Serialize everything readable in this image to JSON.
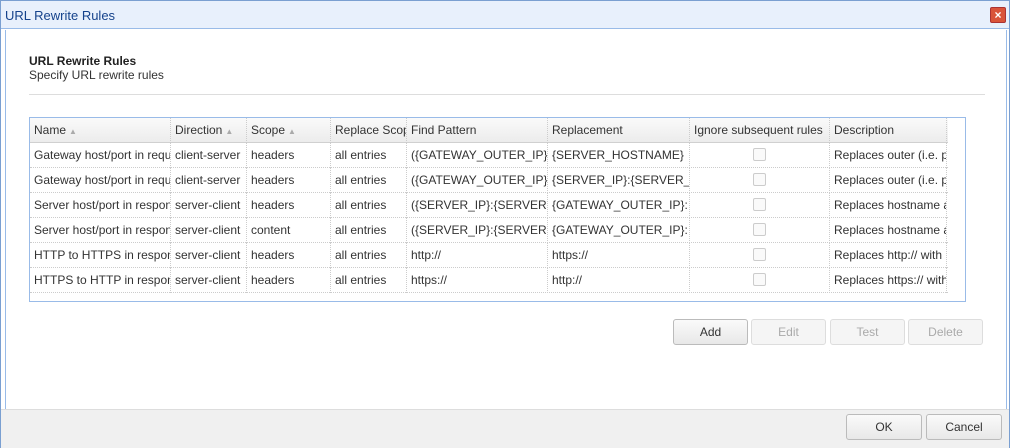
{
  "window": {
    "title": "URL Rewrite Rules",
    "close_icon": "close-icon"
  },
  "header": {
    "title": "URL Rewrite Rules",
    "subtitle": "Specify URL rewrite rules"
  },
  "grid": {
    "columns": [
      {
        "label": "Name",
        "sortable": true
      },
      {
        "label": "Direction",
        "sortable": true
      },
      {
        "label": "Scope",
        "sortable": true
      },
      {
        "label": "Replace Scope",
        "sortable": false
      },
      {
        "label": "Find Pattern",
        "sortable": false
      },
      {
        "label": "Replacement",
        "sortable": false
      },
      {
        "label": "Ignore subsequent rules",
        "sortable": false
      },
      {
        "label": "Description",
        "sortable": false
      }
    ],
    "rows": [
      [
        "Gateway host/port in request",
        "client-server",
        "headers",
        "all entries",
        "({GATEWAY_OUTER_IP}",
        "{SERVER_HOSTNAME}",
        false,
        "Replaces outer (i.e. p"
      ],
      [
        "Gateway host/port in request",
        "client-server",
        "headers",
        "all entries",
        "({GATEWAY_OUTER_IP}",
        "{SERVER_IP}:{SERVER_",
        false,
        "Replaces outer (i.e. p"
      ],
      [
        "Server host/port in response",
        "server-client",
        "headers",
        "all entries",
        "({SERVER_IP}:{SERVER",
        "{GATEWAY_OUTER_IP}:",
        false,
        "Replaces hostname a"
      ],
      [
        "Server host/port in response",
        "server-client",
        "content",
        "all entries",
        "({SERVER_IP}:{SERVER",
        "{GATEWAY_OUTER_IP}:",
        false,
        "Replaces hostname a"
      ],
      [
        "HTTP to HTTPS in response",
        "server-client",
        "headers",
        "all entries",
        "http://",
        "https://",
        false,
        "Replaces http:// with"
      ],
      [
        "HTTPS to HTTP in response",
        "server-client",
        "headers",
        "all entries",
        "https://",
        "http://",
        false,
        "Replaces https:// with"
      ]
    ]
  },
  "actions": {
    "add": "Add",
    "edit": "Edit",
    "test": "Test",
    "delete": "Delete"
  },
  "footer": {
    "ok": "OK",
    "cancel": "Cancel"
  }
}
